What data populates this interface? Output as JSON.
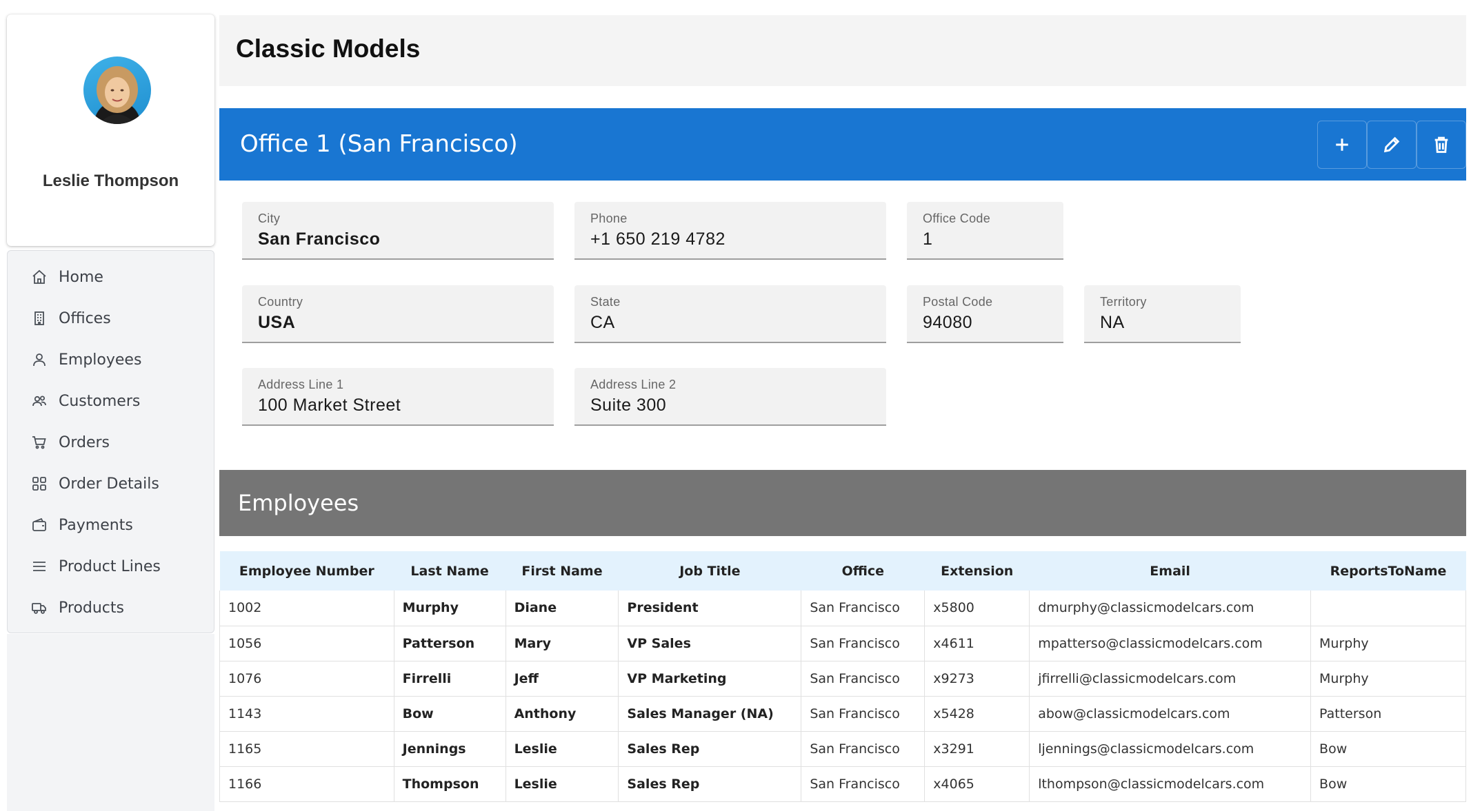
{
  "app": {
    "title": "Classic Models"
  },
  "user": {
    "name": "Leslie Thompson"
  },
  "sidebar": {
    "items": [
      {
        "label": "Home",
        "icon": "home-icon"
      },
      {
        "label": "Offices",
        "icon": "building-icon"
      },
      {
        "label": "Employees",
        "icon": "person-icon"
      },
      {
        "label": "Customers",
        "icon": "people-icon"
      },
      {
        "label": "Orders",
        "icon": "cart-icon"
      },
      {
        "label": "Order Details",
        "icon": "grid-icon"
      },
      {
        "label": "Payments",
        "icon": "wallet-icon"
      },
      {
        "label": "Product Lines",
        "icon": "menu-icon"
      },
      {
        "label": "Products",
        "icon": "truck-icon"
      }
    ]
  },
  "office": {
    "title": "Office 1 (San Francisco)",
    "fields": {
      "city": {
        "label": "City",
        "value": "San Francisco"
      },
      "phone": {
        "label": "Phone",
        "value": "+1 650 219 4782"
      },
      "office_code": {
        "label": "Office Code",
        "value": "1"
      },
      "country": {
        "label": "Country",
        "value": "USA"
      },
      "state": {
        "label": "State",
        "value": "CA"
      },
      "postal_code": {
        "label": "Postal Code",
        "value": "94080"
      },
      "territory": {
        "label": "Territory",
        "value": "NA"
      },
      "address1": {
        "label": "Address Line 1",
        "value": "100 Market Street"
      },
      "address2": {
        "label": "Address Line 2",
        "value": "Suite 300"
      }
    }
  },
  "employees": {
    "title": "Employees",
    "columns": [
      "Employee Number",
      "Last Name",
      "First Name",
      "Job Title",
      "Office",
      "Extension",
      "Email",
      "ReportsToName"
    ],
    "rows": [
      [
        "1002",
        "Murphy",
        "Diane",
        "President",
        "San Francisco",
        "x5800",
        "dmurphy@classicmodelcars.com",
        ""
      ],
      [
        "1056",
        "Patterson",
        "Mary",
        "VP Sales",
        "San Francisco",
        "x4611",
        "mpatterso@classicmodelcars.com",
        "Murphy"
      ],
      [
        "1076",
        "Firrelli",
        "Jeff",
        "VP Marketing",
        "San Francisco",
        "x9273",
        "jfirrelli@classicmodelcars.com",
        "Murphy"
      ],
      [
        "1143",
        "Bow",
        "Anthony",
        "Sales Manager (NA)",
        "San Francisco",
        "x5428",
        "abow@classicmodelcars.com",
        "Patterson"
      ],
      [
        "1165",
        "Jennings",
        "Leslie",
        "Sales Rep",
        "San Francisco",
        "x3291",
        "ljennings@classicmodelcars.com",
        "Bow"
      ],
      [
        "1166",
        "Thompson",
        "Leslie",
        "Sales Rep",
        "San Francisco",
        "x4065",
        "lthompson@classicmodelcars.com",
        "Bow"
      ]
    ]
  },
  "toolbar": {
    "icons": [
      "plus-icon",
      "pencil-icon",
      "trash-icon"
    ]
  },
  "colors": {
    "primary": "#1976d2",
    "section_header": "#757575",
    "table_header": "#e3f2fd"
  }
}
